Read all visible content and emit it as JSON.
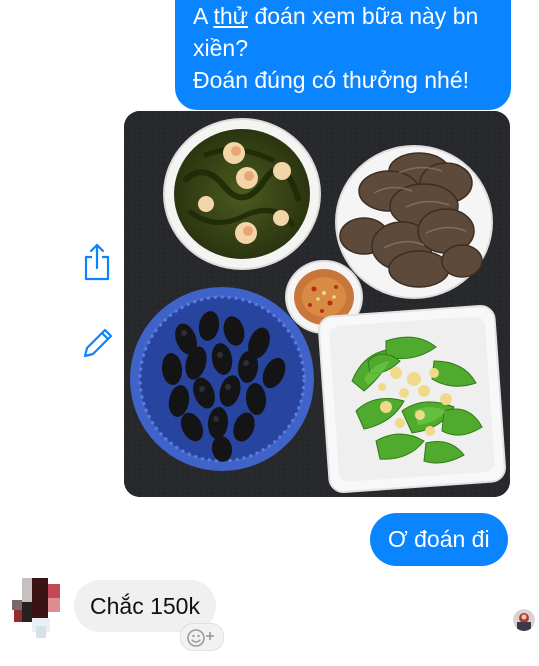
{
  "messages": {
    "outgoing_1": {
      "line_1_prefix": "A ",
      "line_1_underlined": "thử",
      "line_1_suffix": " đoán xem bữa này bn",
      "line_2": "xiền?",
      "line_3": "Đoán đúng có thưởng nhé!"
    },
    "outgoing_2": "Ơ đoán đi",
    "incoming_1": "Chắc 150k"
  },
  "side_actions": {
    "share_icon": "share-icon",
    "edit_icon": "pencil-icon"
  },
  "colors": {
    "outgoing_bubble": "#0a84ff",
    "incoming_bubble": "#f0f0f0",
    "icon_blue": "#0a84ff"
  }
}
